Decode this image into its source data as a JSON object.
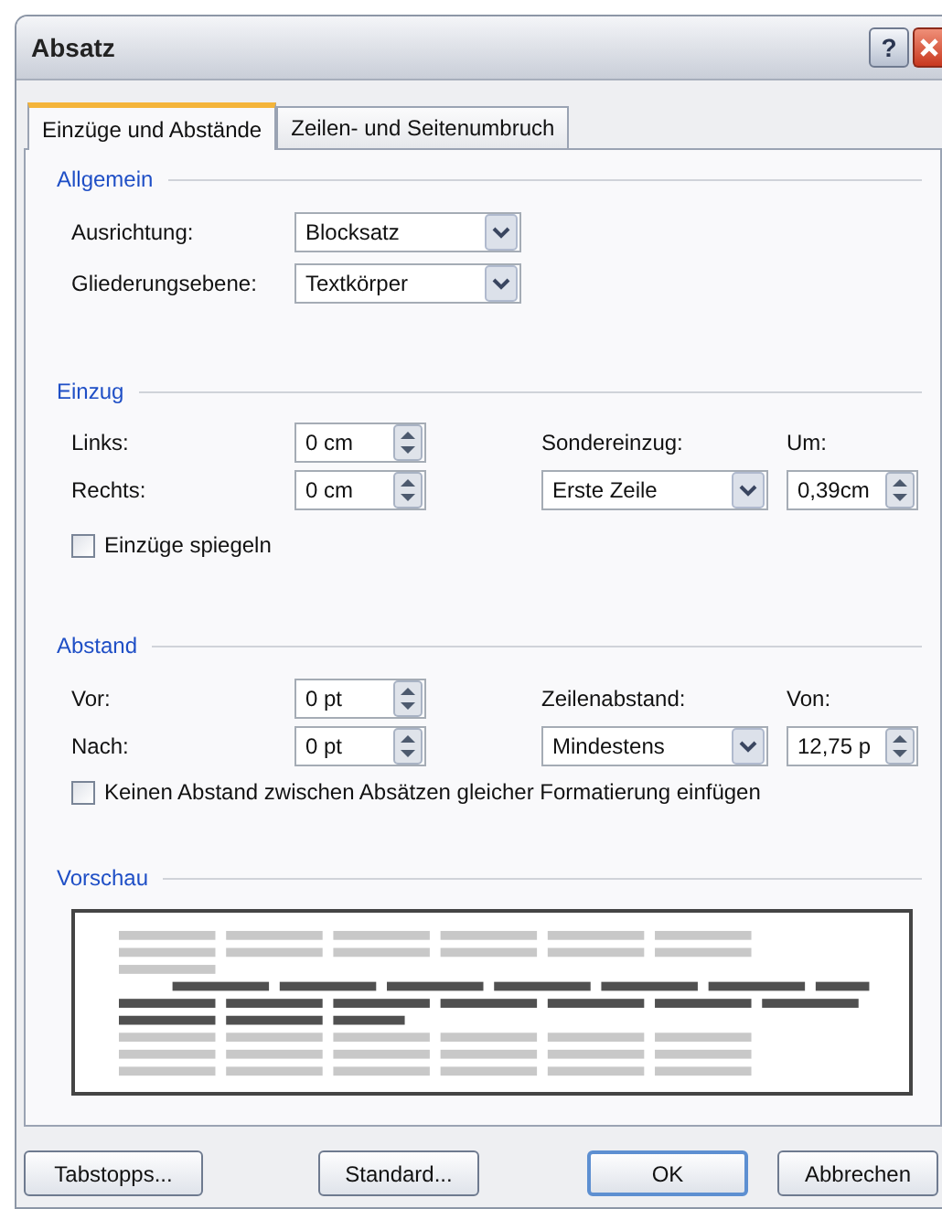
{
  "window": {
    "title": "Absatz",
    "help": "?"
  },
  "tabs": [
    {
      "label": "Einzüge und Abstände",
      "selected": true
    },
    {
      "label": "Zeilen- und Seitenumbruch",
      "selected": false
    }
  ],
  "allgemein": {
    "heading": "Allgemein",
    "rows": [
      {
        "label": "Ausrichtung:",
        "value": "Blocksatz"
      },
      {
        "label": "Gliederungsebene:",
        "value": "Textkörper"
      }
    ]
  },
  "einzug": {
    "heading": "Einzug",
    "rows": [
      {
        "label": "Links:",
        "value": "0 cm"
      },
      {
        "label": "Rechts:",
        "value": "0 cm"
      }
    ],
    "special": {
      "label": "Sondereinzug:",
      "value": "Erste Zeile"
    },
    "amount": {
      "label": "Um:",
      "value": "0,39cm"
    },
    "checkbox": {
      "label": "Einzüge spiegeln",
      "checked": false
    }
  },
  "abstand": {
    "heading": "Abstand",
    "rows": [
      {
        "label": "Vor:",
        "value": "0 pt"
      },
      {
        "label": "Nach:",
        "value": "0 pt"
      }
    ],
    "special": {
      "label": "Zeilenabstand:",
      "value": "Mindestens"
    },
    "amount": {
      "label": "Von:",
      "value": "12,75 p"
    },
    "checkbox": {
      "label": "Keinen Abstand zwischen Absätzen gleicher Formatierung einfügen",
      "checked": false
    }
  },
  "preview": {
    "heading": "Vorschau"
  },
  "buttons": [
    {
      "label": "Tabstopps...",
      "default": false
    },
    {
      "label": "Standard...",
      "default": false
    },
    {
      "label": "OK",
      "default": true
    },
    {
      "label": "Abbrechen",
      "default": false
    }
  ]
}
